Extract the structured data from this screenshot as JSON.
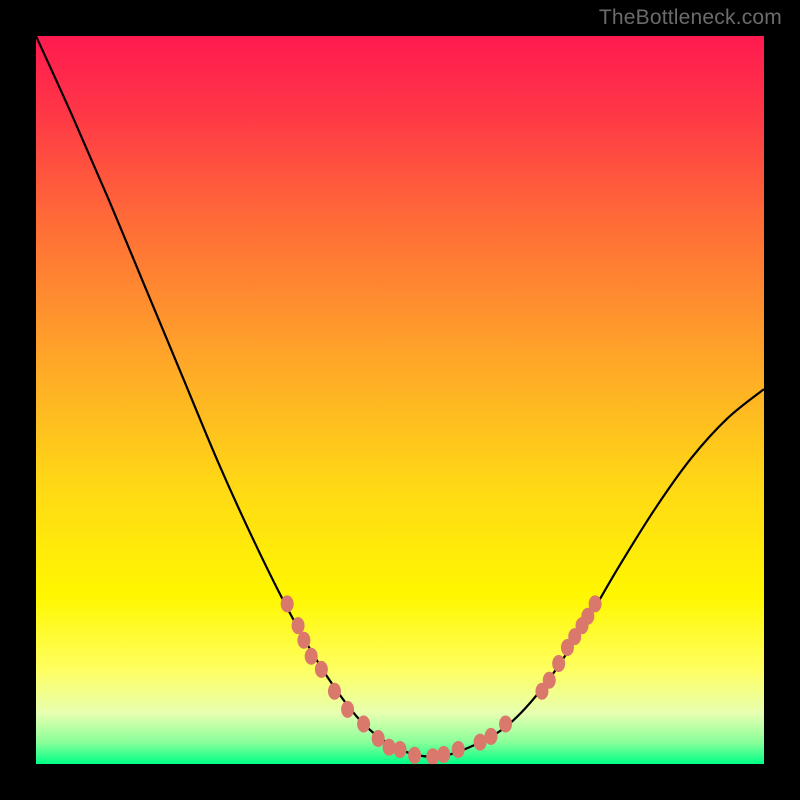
{
  "watermark": "TheBottleneck.com",
  "chart_data": {
    "type": "line",
    "title": "",
    "xlabel": "",
    "ylabel": "",
    "xlim": [
      0,
      1
    ],
    "ylim": [
      0,
      1
    ],
    "series": [
      {
        "name": "curve",
        "stroke": "#000000",
        "x": [
          0.0,
          0.05,
          0.1,
          0.15,
          0.2,
          0.25,
          0.3,
          0.35,
          0.4,
          0.45,
          0.5,
          0.55,
          0.6,
          0.65,
          0.7,
          0.75,
          0.8,
          0.85,
          0.9,
          0.95,
          1.0
        ],
        "y": [
          1.0,
          0.89,
          0.775,
          0.655,
          0.535,
          0.415,
          0.305,
          0.205,
          0.12,
          0.055,
          0.02,
          0.01,
          0.025,
          0.055,
          0.11,
          0.185,
          0.27,
          0.35,
          0.42,
          0.475,
          0.515
        ]
      }
    ],
    "markers": {
      "color": "#D9786B",
      "points": [
        {
          "x": 0.345,
          "y": 0.22
        },
        {
          "x": 0.36,
          "y": 0.19
        },
        {
          "x": 0.368,
          "y": 0.17
        },
        {
          "x": 0.378,
          "y": 0.148
        },
        {
          "x": 0.392,
          "y": 0.13
        },
        {
          "x": 0.41,
          "y": 0.1
        },
        {
          "x": 0.428,
          "y": 0.075
        },
        {
          "x": 0.45,
          "y": 0.055
        },
        {
          "x": 0.47,
          "y": 0.035
        },
        {
          "x": 0.485,
          "y": 0.023
        },
        {
          "x": 0.5,
          "y": 0.02
        },
        {
          "x": 0.52,
          "y": 0.012
        },
        {
          "x": 0.545,
          "y": 0.01
        },
        {
          "x": 0.56,
          "y": 0.013
        },
        {
          "x": 0.58,
          "y": 0.02
        },
        {
          "x": 0.61,
          "y": 0.03
        },
        {
          "x": 0.625,
          "y": 0.038
        },
        {
          "x": 0.645,
          "y": 0.055
        },
        {
          "x": 0.695,
          "y": 0.1
        },
        {
          "x": 0.705,
          "y": 0.115
        },
        {
          "x": 0.718,
          "y": 0.138
        },
        {
          "x": 0.73,
          "y": 0.16
        },
        {
          "x": 0.74,
          "y": 0.175
        },
        {
          "x": 0.75,
          "y": 0.19
        },
        {
          "x": 0.758,
          "y": 0.203
        },
        {
          "x": 0.768,
          "y": 0.22
        }
      ]
    },
    "background_gradient": {
      "stops": [
        {
          "offset": 0.0,
          "color": "#ff1a50"
        },
        {
          "offset": 0.1,
          "color": "#ff3547"
        },
        {
          "offset": 0.25,
          "color": "#ff6a38"
        },
        {
          "offset": 0.45,
          "color": "#ffa828"
        },
        {
          "offset": 0.62,
          "color": "#ffd915"
        },
        {
          "offset": 0.77,
          "color": "#fff700"
        },
        {
          "offset": 0.87,
          "color": "#ffff60"
        },
        {
          "offset": 0.93,
          "color": "#e7ffb0"
        },
        {
          "offset": 0.97,
          "color": "#8aff9a"
        },
        {
          "offset": 1.0,
          "color": "#00ff87"
        }
      ]
    }
  }
}
